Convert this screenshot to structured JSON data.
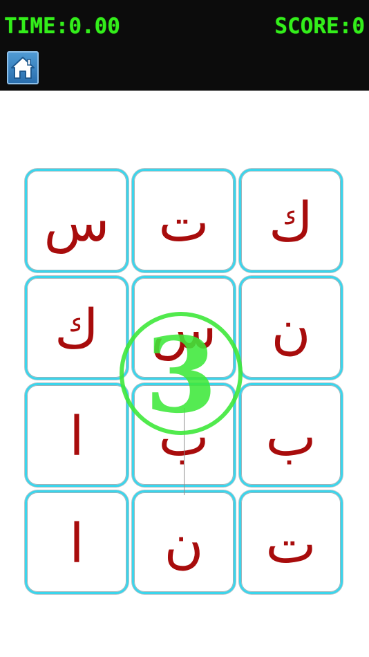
{
  "hud": {
    "time_text": "TIME:0.00",
    "score_text": "SCORE:0",
    "home_icon": "home-icon",
    "text_color": "#33ee1a"
  },
  "board": {
    "rows": [
      [
        "س",
        "ت",
        "ك"
      ],
      [
        "ك",
        "س",
        "ن"
      ],
      [
        "ا",
        "ب",
        "ب"
      ],
      [
        "ا",
        "ن",
        "ت"
      ]
    ],
    "tile_border_color": "#3ad5ec",
    "letter_color": "#a80c0c"
  },
  "countdown": {
    "value": "3",
    "color": "#3ee83a"
  }
}
